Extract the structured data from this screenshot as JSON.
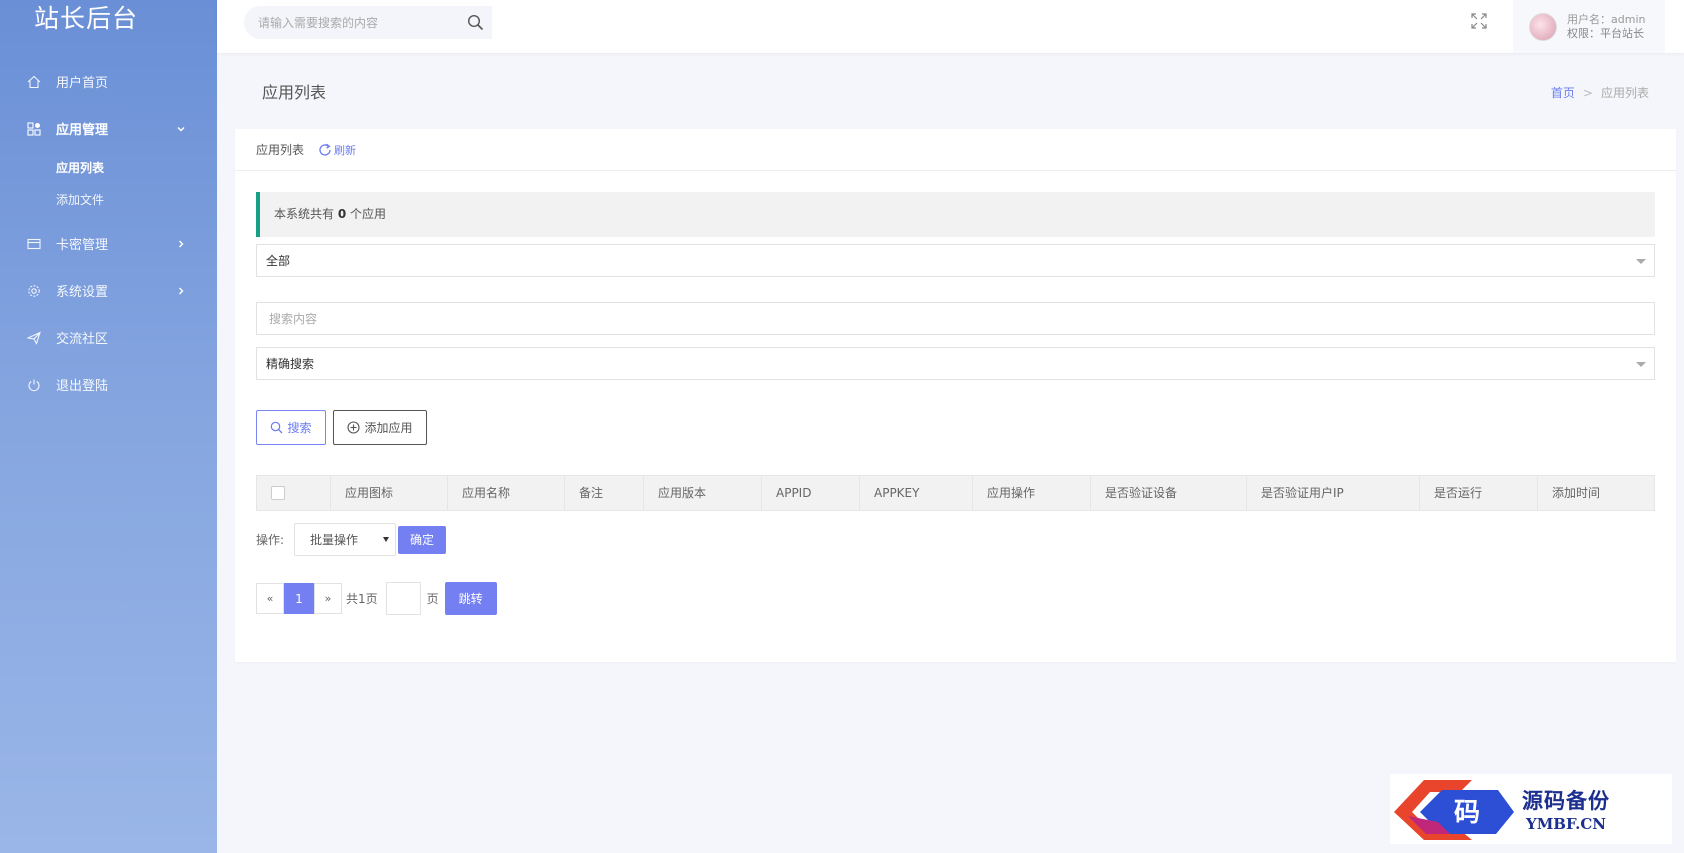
{
  "sidebar": {
    "brand": "站长后台",
    "items": [
      {
        "label": "用户首页",
        "icon": "home-icon"
      },
      {
        "label": "应用管理",
        "icon": "apps-icon",
        "expanded": true
      },
      {
        "label": "卡密管理",
        "icon": "card-icon"
      },
      {
        "label": "系统设置",
        "icon": "gear-icon"
      },
      {
        "label": "交流社区",
        "icon": "send-icon"
      },
      {
        "label": "退出登陆",
        "icon": "power-icon"
      }
    ],
    "sub_items": [
      {
        "label": "应用列表",
        "active": true
      },
      {
        "label": "添加文件"
      }
    ]
  },
  "header": {
    "search_placeholder": "请输入需要搜索的内容",
    "user_name": "用户名：admin",
    "user_role": "权限：平台站长"
  },
  "page": {
    "title": "应用列表",
    "breadcrumb_home": "首页",
    "breadcrumb_current": "应用列表"
  },
  "card": {
    "title": "应用列表",
    "refresh": "刷新",
    "notice_prefix": "本系统共有",
    "notice_count": "0",
    "notice_suffix": "个应用",
    "filter_value": "全部",
    "search_placeholder": "搜索内容",
    "mode_value": "精确搜索",
    "search_button": "搜索",
    "add_button": "添加应用"
  },
  "table": {
    "columns": [
      "应用图标",
      "应用名称",
      "备注",
      "应用版本",
      "APPID",
      "APPKEY",
      "应用操作",
      "是否验证设备",
      "是否验证用户IP",
      "是否运行",
      "添加时间"
    ]
  },
  "batch": {
    "label": "操作:",
    "select_value": "批量操作",
    "confirm": "确定"
  },
  "pager": {
    "prev": "«",
    "current": "1",
    "next": "»",
    "total": "共1页",
    "unit": "页",
    "go": "跳转"
  },
  "watermark": {
    "glyph": "码",
    "cn": "源码备份",
    "en": "YMBF.CN"
  },
  "colors": {
    "accent": "#7480f2",
    "notice_bar": "#17a086",
    "sidebar_top": "#6a8fd6",
    "sidebar_bottom": "#9ab6e8"
  }
}
